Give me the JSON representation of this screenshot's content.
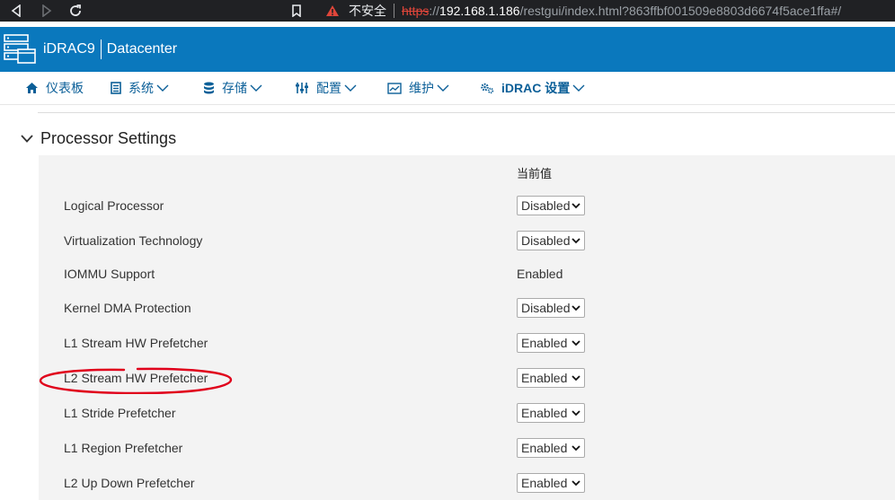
{
  "browser": {
    "warning_text": "不安全",
    "url_scheme": "https",
    "url_sep": "://",
    "url_host": "192.168.1.186",
    "url_path": "/restgui/index.html?863ffbf001509e8803d6674f5ace1ffa#/"
  },
  "header": {
    "product_name": "iDRAC9",
    "edition": "Datacenter"
  },
  "nav": [
    {
      "label": "仪表板",
      "icon": "home-icon"
    },
    {
      "label": "系统",
      "icon": "server-icon"
    },
    {
      "label": "存储",
      "icon": "database-icon"
    },
    {
      "label": "配置",
      "icon": "sliders-icon"
    },
    {
      "label": "维护",
      "icon": "monitor-chart-icon"
    },
    {
      "label": "iDRAC 设置",
      "icon": "gears-icon"
    }
  ],
  "section": {
    "title": "Processor Settings",
    "column_header": "当前值"
  },
  "settings": [
    {
      "label": "Logical Processor",
      "value": "Disabled",
      "type": "select"
    },
    {
      "label": "Virtualization Technology",
      "value": "Disabled",
      "type": "select"
    },
    {
      "label": "IOMMU Support",
      "value": "Enabled",
      "type": "static"
    },
    {
      "label": "Kernel DMA Protection",
      "value": "Disabled",
      "type": "select"
    },
    {
      "label": "L1 Stream HW Prefetcher",
      "value": "Enabled",
      "type": "select"
    },
    {
      "label": "L2 Stream HW Prefetcher",
      "value": "Enabled",
      "type": "select",
      "highlighted": true
    },
    {
      "label": "L1 Stride Prefetcher",
      "value": "Enabled",
      "type": "select"
    },
    {
      "label": "L1 Region Prefetcher",
      "value": "Enabled",
      "type": "select"
    },
    {
      "label": "L2 Up Down Prefetcher",
      "value": "Enabled",
      "type": "select"
    }
  ],
  "colors": {
    "header_blue": "#0a78bd",
    "nav_text": "#0b5f98",
    "annotation_red": "#e0001b",
    "panel_bg": "#f3f3f3"
  }
}
